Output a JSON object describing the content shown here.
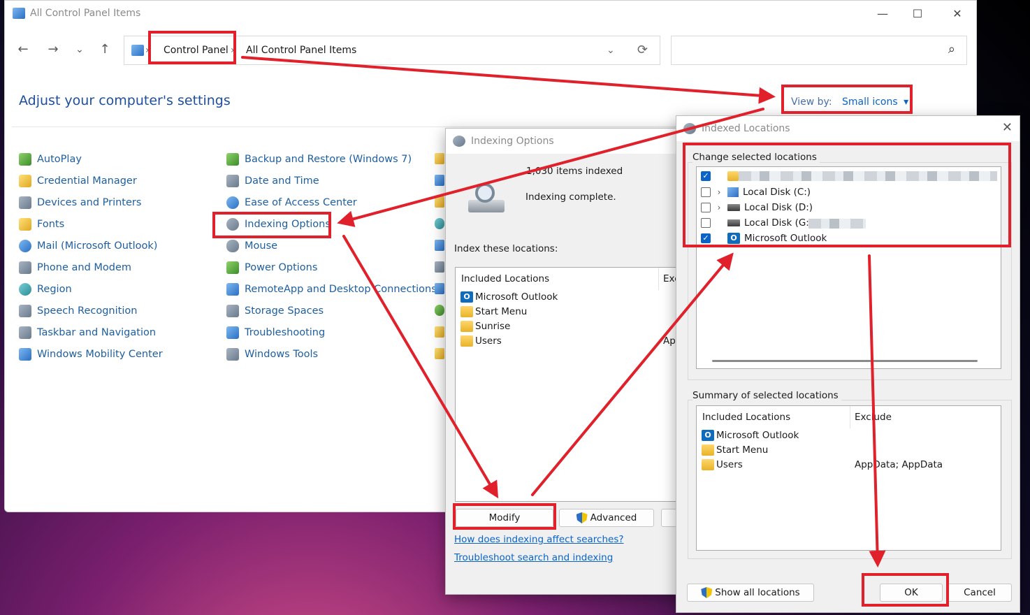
{
  "cp_window": {
    "title": "All Control Panel Items",
    "controls": {
      "minimize": "—",
      "maximize": "☐",
      "close": "✕"
    },
    "nav": {
      "back": "←",
      "forward": "→",
      "recent": "⌄",
      "up": "↑",
      "refresh": "⟳",
      "dropdown": "⌄"
    },
    "breadcrumb": {
      "sep": "›",
      "item1": "Control Panel",
      "item2": "All Control Panel Items"
    },
    "search_icon": "⌕",
    "heading": "Adjust your computer's settings",
    "viewby": {
      "label": "View by:",
      "value": "Small icons",
      "arrow": "▾"
    },
    "col1": [
      "AutoPlay",
      "Credential Manager",
      "Devices and Printers",
      "Fonts",
      "Mail (Microsoft Outlook)",
      "Phone and Modem",
      "Region",
      "Speech Recognition",
      "Taskbar and Navigation",
      "Windows Mobility Center"
    ],
    "col2": [
      "Backup and Restore (Windows 7)",
      "Date and Time",
      "Ease of Access Center",
      "Indexing Options",
      "Mouse",
      "Power Options",
      "RemoteApp and Desktop Connections",
      "Storage Spaces",
      "Troubleshooting",
      "Windows Tools"
    ]
  },
  "indexing_dialog": {
    "title": "Indexing Options",
    "items_indexed": "1,030 items indexed",
    "status": "Indexing complete.",
    "index_label": "Index these locations:",
    "col_included": "Included Locations",
    "col_exclude": "Exc",
    "exclude_fragment": "Ap",
    "locations": [
      "Microsoft Outlook",
      "Start Menu",
      "Sunrise",
      "Users"
    ],
    "outlook_glyph": "O",
    "modify_button": "Modify",
    "advanced_button": "Advanced",
    "link_how": "How does indexing affect searches?",
    "link_troubleshoot": "Troubleshoot search and indexing"
  },
  "locations_dialog": {
    "title": "Indexed Locations",
    "close": "✕",
    "change_label": "Change selected locations",
    "tree": [
      {
        "label": "Local Disk (C:)",
        "checked": false,
        "expand": "›"
      },
      {
        "label": "Local Disk (D:)",
        "checked": false,
        "expand": "›"
      },
      {
        "label": "Local Disk (G:)",
        "checked": false,
        "expand": ""
      },
      {
        "label": "Microsoft Outlook",
        "checked": true,
        "expand": ""
      }
    ],
    "check_glyph": "✓",
    "outlook_glyph": "O",
    "summary_label": "Summary of selected locations",
    "col_included": "Included Locations",
    "col_exclude": "Exclude",
    "summary_rows": [
      "Microsoft Outlook",
      "Start Menu",
      "Users"
    ],
    "users_exclude": "AppData; AppData",
    "show_all_button": "Show all locations",
    "ok_button": "OK",
    "cancel_button": "Cancel"
  },
  "colors": {
    "annotation_red": "#e0202a",
    "link_blue": "#0a64c8",
    "cp_link": "#1e5fa0",
    "heading_blue": "#1e4f9e"
  }
}
